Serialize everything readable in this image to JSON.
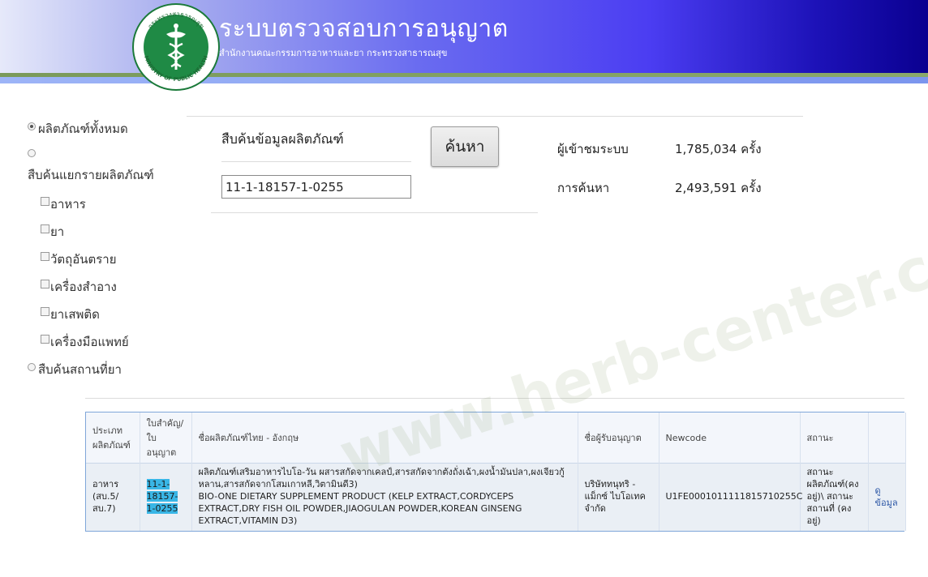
{
  "header": {
    "title": "ระบบตรวจสอบการอนุญาต",
    "subtitle": "สำนักงานคณะกรรมการอาหารและยา กระทรวงสาธารณสุข",
    "logo_text_top": "กระทรวงสาธารณสุข",
    "logo_text_bottom": "MINISTRY OF PUBLIC HEALTH"
  },
  "filters": {
    "all_products": "ผลิตภัณฑ์ทั้งหมด",
    "by_type": "สืบค้นแยกรายผลิตภัณฑ์",
    "categories": [
      {
        "label": "อาหาร",
        "checked": false
      },
      {
        "label": "ยา",
        "checked": false
      },
      {
        "label": "วัตถุอันตราย",
        "checked": false
      },
      {
        "label": "เครื่องสำอาง",
        "checked": false
      },
      {
        "label": "ยาเสพติด",
        "checked": false
      },
      {
        "label": "เครื่องมือแพทย์",
        "checked": false
      }
    ],
    "by_location": "สืบค้นสถานที่ยา"
  },
  "search": {
    "title": "สืบค้นข้อมูลผลิตภัณฑ์",
    "value": "11-1-18157-1-0255",
    "button": "ค้นหา"
  },
  "stats": {
    "visitors_label": "ผู้เข้าชมระบบ",
    "visitors_value": "1,785,034 ครั้ง",
    "searches_label": "การค้นหา",
    "searches_value": "2,493,591 ครั้ง"
  },
  "table": {
    "headers": [
      "ประเภท ผลิตภัณฑ์",
      "ใบสำคัญ/ใบ อนุญาต",
      "ชื่อผลิตภัณฑ์ไทย - อังกฤษ",
      "ชื่อผู้รับอนุญาต",
      "Newcode",
      "สถานะ",
      ""
    ],
    "rows": [
      {
        "type": "อาหาร (สบ.5/สบ.7)",
        "license": "11-1-18157-1-0255",
        "name_th": "ผลิตภัณฑ์เสริมอาหารไบโอ-วัน ผสารสกัดจากเคลป์,สารสกัดจากตังถั่งเฉ้า,ผงน้ำมันปลา,ผงเจียวกู้หลาน,สารสกัดจากโสมเกาหลี,วิตามินดี3)",
        "name_en": "BIO-ONE DIETARY SUPPLEMENT PRODUCT (KELP EXTRACT,CORDYCEPS EXTRACT,DRY FISH OIL POWDER,JIAOGULAN POWDER,KOREAN GINSENG EXTRACT,VITAMIN D3)",
        "licensee": "บริษัททนุทริ - แม็กซ์ ไบโอเทค จำกัด",
        "newcode": "U1FE00010111118157102 55C",
        "newcode_full": "U1FE0001011111815710255C",
        "status": "สถานะผลิตภัณฑ์(คงอยู่)\\ สถานะสถานที่ (คงอยู่)",
        "action": "ดูข้อมูล"
      }
    ]
  },
  "watermark": "www.herb-center.com"
}
